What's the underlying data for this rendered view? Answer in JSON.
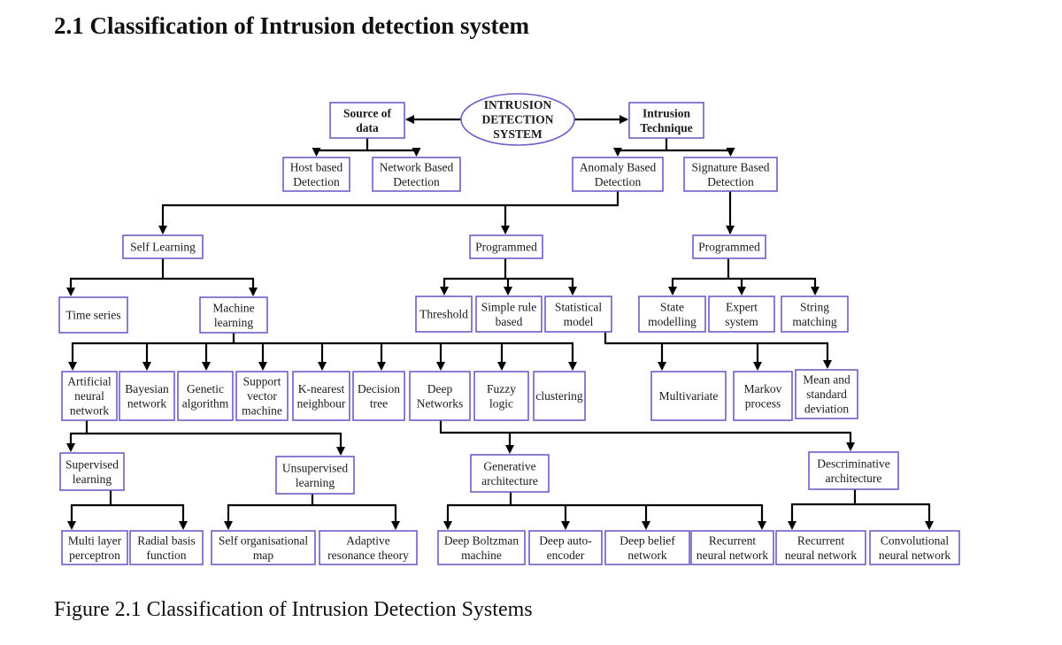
{
  "section_heading": "2.1 Classification of Intrusion detection system",
  "figure_caption": "Figure 2.1 Classification of Intrusion Detection Systems",
  "colors": {
    "node_border": "#6a5fc8",
    "edge": "#000000",
    "text": "#1a1a1a"
  },
  "diagram": {
    "type": "hierarchy-tree",
    "root": "ids",
    "nodes": {
      "ids": {
        "lines": [
          "INTRUSION",
          "DETECTION",
          "SYSTEM"
        ],
        "shape": "ellipse",
        "bold": true
      },
      "source": {
        "lines": [
          "Source of",
          "data"
        ],
        "bold": true
      },
      "technique": {
        "lines": [
          "Intrusion",
          "Technique"
        ],
        "bold": true
      },
      "host": {
        "lines": [
          "Host based",
          "Detection"
        ]
      },
      "network": {
        "lines": [
          "Network Based",
          "Detection"
        ]
      },
      "anomaly": {
        "lines": [
          "Anomaly Based",
          "Detection"
        ]
      },
      "signature": {
        "lines": [
          "Signature Based",
          "Detection"
        ]
      },
      "self_learning": {
        "lines": [
          "Self Learning"
        ]
      },
      "programmed_a": {
        "lines": [
          "Programmed"
        ]
      },
      "programmed_s": {
        "lines": [
          "Programmed"
        ]
      },
      "time_series": {
        "lines": [
          "Time series"
        ]
      },
      "machine_learning": {
        "lines": [
          "Machine",
          "learning"
        ]
      },
      "threshold": {
        "lines": [
          "Threshold"
        ]
      },
      "simple_rule": {
        "lines": [
          "Simple rule",
          "based"
        ]
      },
      "statistical": {
        "lines": [
          "Statistical",
          "model"
        ]
      },
      "state_modelling": {
        "lines": [
          "State",
          "modelling"
        ]
      },
      "expert_system": {
        "lines": [
          "Expert",
          "system"
        ]
      },
      "string_matching": {
        "lines": [
          "String",
          "matching"
        ]
      },
      "ann": {
        "lines": [
          "Artificial",
          "neural",
          "network"
        ]
      },
      "bayesian": {
        "lines": [
          "Bayesian",
          "network"
        ]
      },
      "genetic": {
        "lines": [
          "Genetic",
          "algorithm"
        ]
      },
      "svm": {
        "lines": [
          "Support",
          "vector",
          "machine"
        ]
      },
      "knn": {
        "lines": [
          "K-nearest",
          "neighbour"
        ]
      },
      "decision_tree": {
        "lines": [
          "Decision",
          "tree"
        ]
      },
      "deep_networks": {
        "lines": [
          "Deep",
          "Networks"
        ]
      },
      "fuzzy": {
        "lines": [
          "Fuzzy",
          "logic"
        ]
      },
      "clustering": {
        "lines": [
          "clustering"
        ]
      },
      "multivariate": {
        "lines": [
          "Multivariate"
        ]
      },
      "markov": {
        "lines": [
          "Markov",
          "process"
        ]
      },
      "mean_sd": {
        "lines": [
          "Mean and",
          "standard",
          "deviation"
        ]
      },
      "supervised": {
        "lines": [
          "Supervised",
          "learning"
        ]
      },
      "unsupervised": {
        "lines": [
          "Unsupervised",
          "learning"
        ]
      },
      "generative": {
        "lines": [
          "Generative",
          "architecture"
        ]
      },
      "discriminative": {
        "lines": [
          "Descriminative",
          "architecture"
        ]
      },
      "mlp": {
        "lines": [
          "Multi layer",
          "perceptron"
        ]
      },
      "rbf": {
        "lines": [
          "Radial basis",
          "function"
        ]
      },
      "som": {
        "lines": [
          "Self organisational",
          "map"
        ]
      },
      "art": {
        "lines": [
          "Adaptive",
          "resonance theory"
        ]
      },
      "dbm": {
        "lines": [
          "Deep Boltzman",
          "machine"
        ]
      },
      "dae": {
        "lines": [
          "Deep auto-",
          "encoder"
        ]
      },
      "dbn": {
        "lines": [
          "Deep belief",
          "network"
        ]
      },
      "rnn_gen": {
        "lines": [
          "Recurrent",
          "neural network"
        ]
      },
      "rnn_disc": {
        "lines": [
          "Recurrent",
          "neural network"
        ]
      },
      "cnn": {
        "lines": [
          "Convolutional",
          "neural network"
        ]
      }
    },
    "edges": [
      {
        "from": "ids",
        "to": [
          "source",
          "technique"
        ]
      },
      {
        "from": "source",
        "to": [
          "host",
          "network"
        ]
      },
      {
        "from": "technique",
        "to": [
          "anomaly",
          "signature"
        ]
      },
      {
        "from": "anomaly",
        "to": [
          "self_learning",
          "programmed_a"
        ]
      },
      {
        "from": "signature",
        "to": [
          "programmed_s"
        ]
      },
      {
        "from": "self_learning",
        "to": [
          "time_series",
          "machine_learning"
        ]
      },
      {
        "from": "programmed_a",
        "to": [
          "threshold",
          "simple_rule",
          "statistical"
        ]
      },
      {
        "from": "programmed_s",
        "to": [
          "state_modelling",
          "expert_system",
          "string_matching"
        ]
      },
      {
        "from": "machine_learning",
        "to": [
          "ann",
          "bayesian",
          "genetic",
          "svm",
          "knn",
          "decision_tree",
          "deep_networks",
          "fuzzy",
          "clustering"
        ]
      },
      {
        "from": "statistical",
        "to": [
          "multivariate",
          "markov",
          "mean_sd"
        ]
      },
      {
        "from": "ann",
        "to": [
          "supervised",
          "unsupervised"
        ]
      },
      {
        "from": "deep_networks",
        "to": [
          "generative",
          "discriminative"
        ]
      },
      {
        "from": "supervised",
        "to": [
          "mlp",
          "rbf"
        ]
      },
      {
        "from": "unsupervised",
        "to": [
          "som",
          "art"
        ]
      },
      {
        "from": "generative",
        "to": [
          "dbm",
          "dae",
          "dbn",
          "rnn_gen"
        ]
      },
      {
        "from": "discriminative",
        "to": [
          "rnn_disc",
          "cnn"
        ]
      }
    ]
  }
}
